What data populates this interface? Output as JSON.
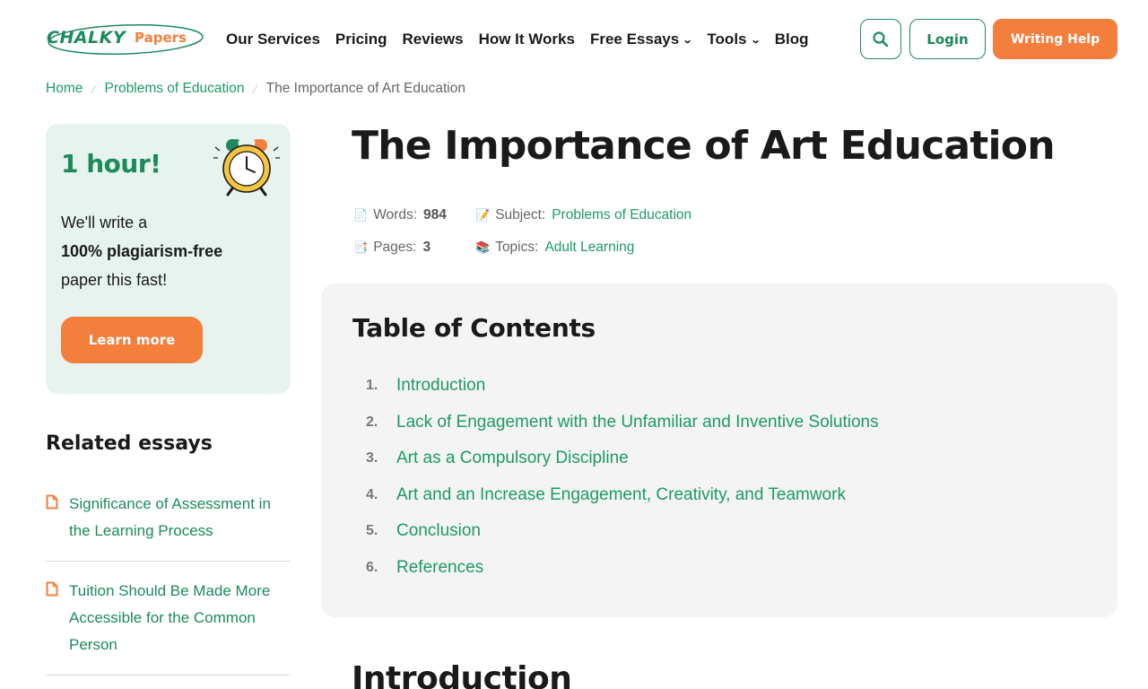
{
  "header": {
    "logo": {
      "part1": "CHALKY",
      "part2": "Papers"
    },
    "nav": [
      {
        "label": "Our Services",
        "dropdown": false
      },
      {
        "label": "Pricing",
        "dropdown": false
      },
      {
        "label": "Reviews",
        "dropdown": false
      },
      {
        "label": "How It Works",
        "dropdown": false
      },
      {
        "label": "Free Essays",
        "dropdown": true
      },
      {
        "label": "Tools",
        "dropdown": true
      },
      {
        "label": "Blog",
        "dropdown": false
      }
    ],
    "search_icon": "search-icon",
    "login_label": "Login",
    "help_label": "Writing Help"
  },
  "breadcrumb": {
    "home": "Home",
    "category": "Problems of Education",
    "current": "The Importance of Art Education"
  },
  "promo": {
    "title": "1 hour!",
    "line1": "We'll write a",
    "line2": "100% plagiarism-free",
    "line3": "paper this fast!",
    "button": "Learn more",
    "icon": "alarm-clock-icon"
  },
  "related": {
    "title": "Related essays",
    "items": [
      "Significance of Assessment in the Learning Process",
      "Tuition Should Be Made More Accessible for the Common Person"
    ]
  },
  "article": {
    "title": "The Importance of Art Education",
    "meta": {
      "words_label": "Words:",
      "words_value": "984",
      "pages_label": "Pages:",
      "pages_value": "3",
      "subject_label": "Subject:",
      "subject_value": "Problems of Education",
      "topics_label": "Topics:",
      "topics_value": "Adult Learning"
    }
  },
  "toc": {
    "title": "Table of Contents",
    "items": [
      {
        "num": "1.",
        "label": "Introduction"
      },
      {
        "num": "2.",
        "label": "Lack of Engagement with the Unfamiliar and Inventive Solutions"
      },
      {
        "num": "3.",
        "label": "Art as a Compulsory Discipline"
      },
      {
        "num": "4.",
        "label": "Art and an Increase Engagement, Creativity, and Teamwork"
      },
      {
        "num": "5.",
        "label": "Conclusion"
      },
      {
        "num": "6.",
        "label": "References"
      }
    ]
  },
  "section": {
    "heading": "Introduction"
  },
  "colors": {
    "brand_green": "#1d8a5c",
    "link_green": "#1d9a66",
    "accent_orange": "#f47e3c",
    "promo_bg": "#e7f3ee",
    "toc_bg": "#f4f4f4"
  }
}
